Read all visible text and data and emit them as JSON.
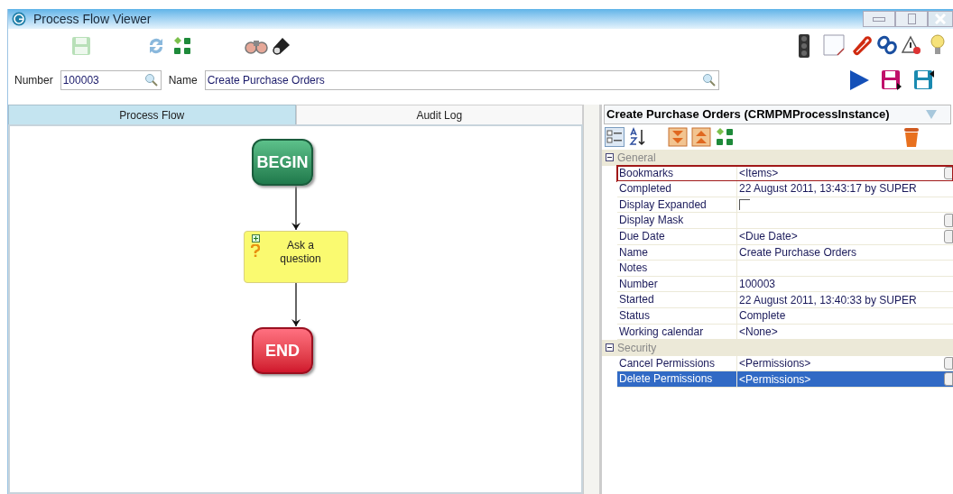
{
  "window": {
    "title": "Process Flow Viewer"
  },
  "fields": [
    {
      "label": "Number",
      "value": "100003"
    },
    {
      "label": "Name",
      "value": "Create Purchase Orders"
    }
  ],
  "tabs": [
    {
      "label": "Process Flow",
      "selected": true
    },
    {
      "label": "Audit Log",
      "selected": false
    }
  ],
  "flow": {
    "nodes": [
      {
        "kind": "begin",
        "label": "BEGIN"
      },
      {
        "kind": "task",
        "label": "Ask a question"
      },
      {
        "kind": "end",
        "label": "END"
      }
    ]
  },
  "properties": {
    "title": "Create Purchase Orders (CRMPMProcessInstance)",
    "categories": [
      {
        "name": "General",
        "expanded": true,
        "rows": [
          {
            "name": "Bookmarks",
            "kind": "text",
            "value": "<Items>",
            "has_button": true,
            "outlined": true,
            "selected": false
          },
          {
            "name": "Completed",
            "kind": "text",
            "value": "22 August 2011, 13:43:17 by SUPER",
            "has_button": false,
            "outlined": false,
            "selected": false
          },
          {
            "name": "Display Expanded",
            "kind": "checkbox",
            "checked": false,
            "has_button": false,
            "outlined": false,
            "selected": false
          },
          {
            "name": "Display Mask",
            "kind": "text",
            "has_button": true,
            "outlined": false,
            "selected": false
          },
          {
            "name": "Due Date",
            "kind": "text",
            "value": "<Due Date>",
            "has_button": true,
            "outlined": false,
            "selected": false
          },
          {
            "name": "Name",
            "kind": "text",
            "value": "Create Purchase Orders",
            "has_button": false,
            "outlined": false,
            "selected": false
          },
          {
            "name": "Notes",
            "kind": "text",
            "has_button": false,
            "outlined": false,
            "selected": false
          },
          {
            "name": "Number",
            "kind": "text",
            "value": "100003",
            "has_button": false,
            "outlined": false,
            "selected": false
          },
          {
            "name": "Started",
            "kind": "text",
            "value": "22 August 2011, 13:40:33 by SUPER",
            "has_button": false,
            "outlined": false,
            "selected": false
          },
          {
            "name": "Status",
            "kind": "text",
            "value": "Complete",
            "has_button": false,
            "outlined": false,
            "selected": false
          },
          {
            "name": "Working calendar",
            "kind": "text",
            "value": "<None>",
            "has_button": false,
            "outlined": false,
            "selected": false
          }
        ]
      },
      {
        "name": "Security",
        "expanded": true,
        "rows": [
          {
            "name": "Cancel Permissions",
            "kind": "text",
            "value": "<Permissions>",
            "has_button": true,
            "outlined": false,
            "selected": false
          },
          {
            "name": "Delete Permissions",
            "kind": "text",
            "value": "<Permissions>",
            "has_button": true,
            "outlined": false,
            "selected": true
          }
        ]
      }
    ]
  }
}
